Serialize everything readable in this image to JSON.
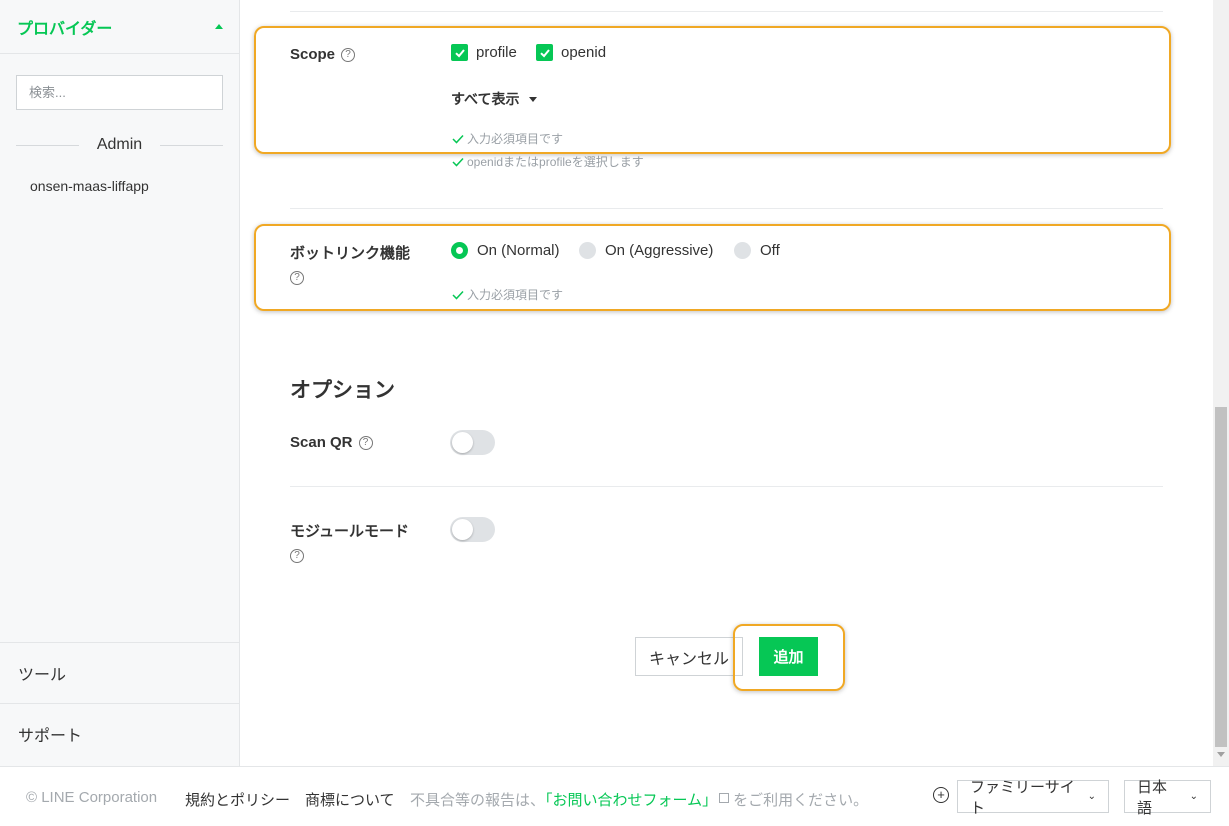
{
  "sidebar": {
    "provider_title": "プロバイダー",
    "search_placeholder": "検索...",
    "admin_label": "Admin",
    "app_item": "onsen-maas-liffapp",
    "tools_label": "ツール",
    "support_label": "サポート"
  },
  "scope": {
    "label": "Scope",
    "options": [
      {
        "label": "profile",
        "checked": true
      },
      {
        "label": "openid",
        "checked": true
      }
    ],
    "show_all": "すべて表示",
    "hint_required": "入力必須項目です",
    "hint_select": "openidまたはprofileを選択します"
  },
  "botlink": {
    "label": "ボットリンク機能",
    "options": [
      {
        "label": "On (Normal)",
        "selected": true
      },
      {
        "label": "On (Aggressive)",
        "selected": false
      },
      {
        "label": "Off",
        "selected": false
      }
    ],
    "hint_required": "入力必須項目です"
  },
  "options_section": {
    "title": "オプション",
    "scan_qr_label": "Scan QR",
    "module_mode_label": "モジュールモード"
  },
  "actions": {
    "cancel": "キャンセル",
    "add": "追加"
  },
  "footer": {
    "copyright": "© LINE Corporation",
    "terms": "規約とポリシー",
    "trademark": "商標について",
    "report_prefix": "不具合等の報告は、",
    "report_link": "「お問い合わせフォーム」",
    "report_suffix": "をご利用ください。",
    "plus_glyph": "+",
    "family_site": "ファミリーサイト",
    "language": "日本語"
  },
  "glyphs": {
    "help": "?",
    "chevron_down": "⌄"
  },
  "colors": {
    "brand_green": "#06c755",
    "highlight_orange": "#f0a824"
  }
}
